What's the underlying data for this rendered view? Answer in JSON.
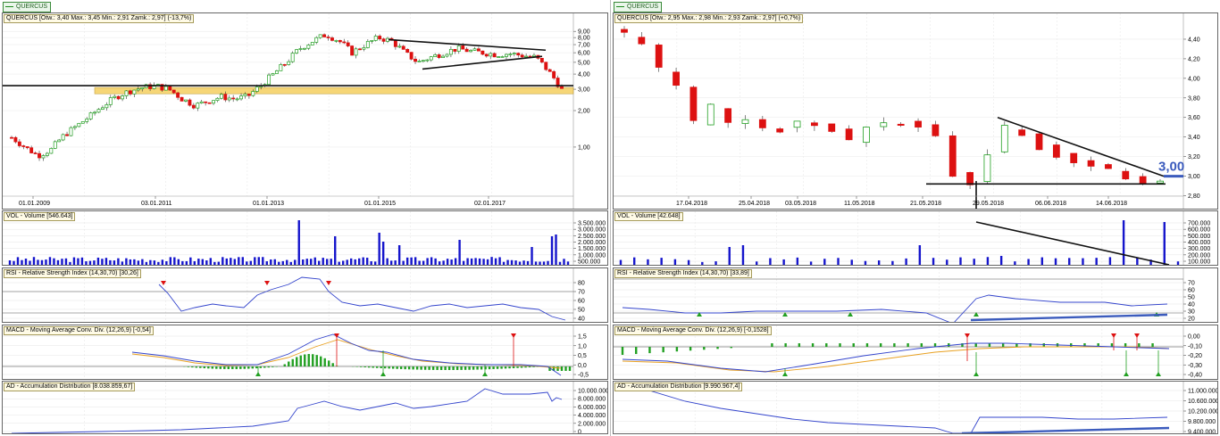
{
  "left": {
    "tab": "QUERCUS",
    "price_label": "QUERCUS [Otw.: 3,40  Max.: 3,45  Min.: 2,91  Zamk.: 2,97] (-13,7%)",
    "price_ticks": [
      "9,00",
      "8,00",
      "7,00",
      "6,00",
      "5,00",
      "4,00",
      "3,00",
      "2,00",
      "1,00"
    ],
    "date_ticks": [
      "01.01.2009",
      "03.01.2011",
      "01.01.2013",
      "01.01.2015",
      "02.01.2017"
    ],
    "vol_label": "VOL - Volume [546.643]",
    "vol_ticks": [
      "3.500.000",
      "3.000.000",
      "2.500.000",
      "2.000.000",
      "1.500.000",
      "1.000.000",
      "500.000"
    ],
    "rsi_label": "RSI - Relative Strength Index (14,30,70) [30,26]",
    "rsi_ticks": [
      "80",
      "70",
      "60",
      "50",
      "40"
    ],
    "macd_label": "MACD - Moving Average Conv. Div. (12,26,9) [-0,54]",
    "macd_ticks": [
      "1,5",
      "1,0",
      "0,5",
      "0,0",
      "-0,5"
    ],
    "ad_label": "AD - Accumulation Distribution [8.038.859,67]",
    "ad_ticks": [
      "10.000.000",
      "8.000.000",
      "6.000.000",
      "4.000.000",
      "2.000.000",
      "0"
    ]
  },
  "right": {
    "tab": "QUERCUS",
    "price_label": "QUERCUS [Otw.: 2,95  Max.: 2,98  Min.: 2,93  Zamk.: 2,97] (+0,7%)",
    "price_ticks": [
      "4,40",
      "4,20",
      "4,00",
      "3,80",
      "3,60",
      "3,40",
      "3,20",
      "3,00",
      "2,80"
    ],
    "date_ticks": [
      "17.04.2018",
      "25.04.2018",
      "03.05.2018",
      "11.05.2018",
      "21.05.2018",
      "29.05.2018",
      "06.06.2018",
      "14.06.2018"
    ],
    "annotation": "3,00",
    "vol_label": "VOL - Volume [42.648]",
    "vol_ticks": [
      "700.000",
      "600.000",
      "500.000",
      "400.000",
      "300.000",
      "200.000",
      "100.000"
    ],
    "rsi_label": "RSI - Relative Strength Index (14,30,70) [33,89]",
    "rsi_ticks": [
      "70",
      "60",
      "50",
      "40",
      "30",
      "20"
    ],
    "macd_label": "MACD - Moving Average Conv. Div. (12,26,9) [-0,1528]",
    "macd_ticks": [
      "0,00",
      "-0,10",
      "-0,20",
      "-0,30",
      "-0,40"
    ],
    "ad_label": "AD - Accumulation Distribution [9.990.967,4]",
    "ad_ticks": [
      "11.000.000",
      "10.600.000",
      "10.200.000",
      "9.800.000",
      "9.400.000"
    ]
  },
  "colors": {
    "up": "#22a022",
    "down": "#dd1111",
    "volume": "#1515cc",
    "line": "#3344cc",
    "signal": "#e8a020",
    "zone": "#f5d060",
    "trend": "#111111",
    "highlight": "#3b5bbd"
  },
  "chart_data": [
    {
      "type": "candlestick",
      "title": "QUERCUS",
      "scale": "log",
      "ylim": [
        0.7,
        9.5
      ],
      "x": [
        "01.01.2009",
        "03.01.2011",
        "01.01.2013",
        "01.01.2015",
        "02.01.2017"
      ],
      "close": [
        1.2,
        1.0,
        0.85,
        0.95,
        1.25,
        1.5,
        1.8,
        2.2,
        2.6,
        2.9,
        3.1,
        3.2,
        3.0,
        2.5,
        2.2,
        2.4,
        2.6,
        2.5,
        2.6,
        3.2,
        4.0,
        5.0,
        6.5,
        7.5,
        8.5,
        7.5,
        6.0,
        7.0,
        8.0,
        7.5,
        6.0,
        5.0,
        5.5,
        6.0,
        6.5,
        6.2,
        6.0,
        5.8,
        5.9,
        5.7,
        5.5,
        4.2,
        2.97
      ],
      "levels": {
        "support": 3.0,
        "zone": [
          2.75,
          3.1
        ]
      }
    },
    {
      "type": "candlestick",
      "title": "QUERCUS",
      "ylim": [
        2.75,
        4.5
      ],
      "x": [
        "17.04.2018",
        "25.04.2018",
        "03.05.2018",
        "11.05.2018",
        "21.05.2018",
        "29.05.2018",
        "06.06.2018",
        "14.06.2018"
      ],
      "close": [
        4.45,
        4.35,
        4.15,
        3.9,
        3.6,
        3.7,
        3.55,
        3.55,
        3.5,
        3.45,
        3.55,
        3.55,
        3.45,
        3.4,
        3.5,
        3.55,
        3.5,
        3.5,
        3.4,
        3.0,
        2.9,
        3.25,
        3.5,
        3.4,
        3.3,
        3.2,
        3.15,
        3.1,
        3.05,
        3.0,
        2.95,
        2.97
      ],
      "levels": {
        "support": 2.9,
        "target": 3.0
      }
    }
  ]
}
